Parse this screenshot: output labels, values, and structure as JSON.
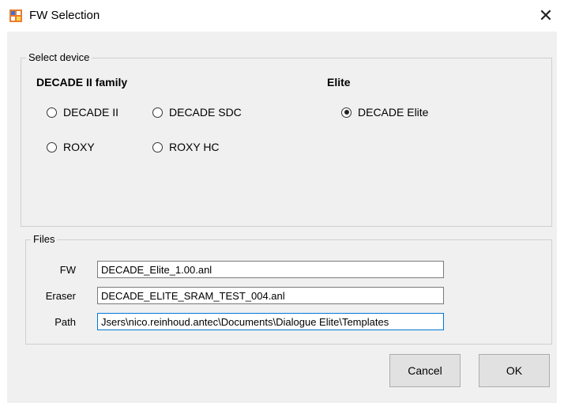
{
  "window": {
    "title": "FW Selection",
    "close_glyph": "✕"
  },
  "select_device": {
    "legend": "Select device",
    "family_heading": "DECADE II family",
    "elite_heading": "Elite",
    "options": [
      {
        "label": "DECADE II",
        "checked": false
      },
      {
        "label": "DECADE SDC",
        "checked": false
      },
      {
        "label": "ROXY",
        "checked": false
      },
      {
        "label": "ROXY HC",
        "checked": false
      },
      {
        "label": "DECADE Elite",
        "checked": true
      }
    ]
  },
  "files": {
    "legend": "Files",
    "fw_label": "FW",
    "fw_value": "DECADE_Elite_1.00.anl",
    "eraser_label": "Eraser",
    "eraser_value": "DECADE_ELITE_SRAM_TEST_004.anl",
    "path_label": "Path",
    "path_value": "Jsers\\nico.reinhoud.antec\\Documents\\Dialogue Elite\\Templates"
  },
  "buttons": {
    "cancel": "Cancel",
    "ok": "OK"
  },
  "colors": {
    "client_bg": "#f0f0f0",
    "focus_border": "#0078d7",
    "icon_orange": "#e87d2c",
    "icon_blue": "#3d6fd8"
  },
  "icons": {
    "app": "form-window-icon"
  }
}
